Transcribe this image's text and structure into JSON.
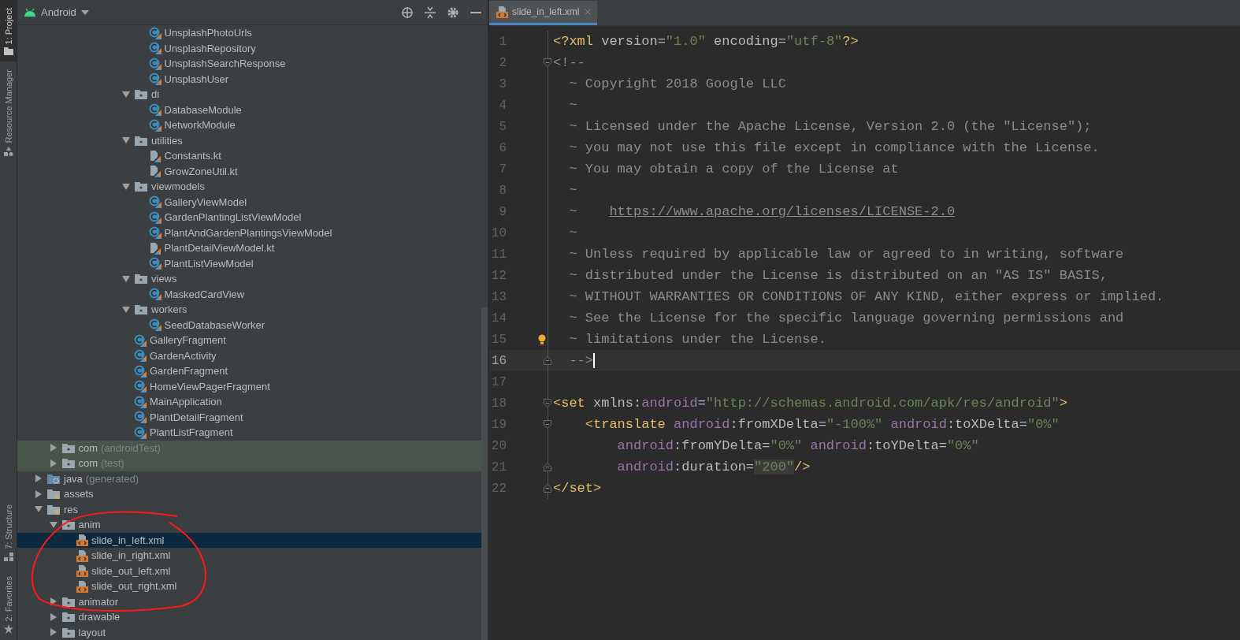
{
  "tool_strip": {
    "top": [
      {
        "label": "1: Project",
        "selected": true,
        "kind": "project"
      },
      {
        "label": "Resource Manager",
        "selected": false,
        "kind": "resources"
      }
    ],
    "bottom": [
      {
        "label": "7: Structure",
        "selected": false,
        "kind": "structure"
      },
      {
        "label": "2: Favorites",
        "selected": false,
        "kind": "favorites"
      }
    ]
  },
  "project": {
    "view": "Android",
    "tree": [
      {
        "children": [
          {
            "children": [
              {
                "children": [
                  {
                    "children": [
                      {
                        "children": [
                          {
                            "children": [
                              {
                                "children": [
                                  {
                                    "label": "UnsplashPhotoUrls",
                                    "kind": "class",
                                    "selected": false
                                  },
                                  {
                                    "label": "UnsplashRepository",
                                    "kind": "class",
                                    "selected": false
                                  },
                                  {
                                    "label": "UnsplashSearchResponse",
                                    "kind": "class",
                                    "selected": false
                                  },
                                  {
                                    "label": "UnsplashUser",
                                    "kind": "class",
                                    "selected": false
                                  }
                                ]
                              },
                              {
                                "label": "di",
                                "kind": "folder",
                                "selected": false,
                                "expanded": true,
                                "children": [
                                  {
                                    "label": "DatabaseModule",
                                    "kind": "class",
                                    "selected": false
                                  },
                                  {
                                    "label": "NetworkModule",
                                    "kind": "class",
                                    "selected": false
                                  }
                                ]
                              },
                              {
                                "label": "utilities",
                                "kind": "folder",
                                "selected": false,
                                "expanded": true,
                                "children": [
                                  {
                                    "label": "Constants.kt",
                                    "kind": "kotlin-file",
                                    "selected": false
                                  },
                                  {
                                    "label": "GrowZoneUtil.kt",
                                    "kind": "kotlin-file",
                                    "selected": false
                                  }
                                ]
                              },
                              {
                                "label": "viewmodels",
                                "kind": "folder",
                                "selected": false,
                                "expanded": true,
                                "children": [
                                  {
                                    "label": "GalleryViewModel",
                                    "kind": "class",
                                    "selected": false
                                  },
                                  {
                                    "label": "GardenPlantingListViewModel",
                                    "kind": "class",
                                    "selected": false
                                  },
                                  {
                                    "label": "PlantAndGardenPlantingsViewModel",
                                    "kind": "class",
                                    "selected": false
                                  },
                                  {
                                    "label": "PlantDetailViewModel.kt",
                                    "kind": "kotlin-file",
                                    "selected": false
                                  },
                                  {
                                    "label": "PlantListViewModel",
                                    "kind": "class",
                                    "selected": false
                                  }
                                ]
                              },
                              {
                                "label": "views",
                                "kind": "folder",
                                "selected": false,
                                "expanded": true,
                                "children": [
                                  {
                                    "label": "MaskedCardView",
                                    "kind": "class",
                                    "selected": false
                                  }
                                ]
                              },
                              {
                                "label": "workers",
                                "kind": "folder",
                                "selected": false,
                                "expanded": true,
                                "children": [
                                  {
                                    "label": "SeedDatabaseWorker",
                                    "kind": "class",
                                    "selected": false
                                  }
                                ]
                              },
                              {
                                "label": "GalleryFragment",
                                "kind": "class",
                                "selected": false
                              },
                              {
                                "label": "GardenActivity",
                                "kind": "class",
                                "selected": false
                              },
                              {
                                "label": "GardenFragment",
                                "kind": "class",
                                "selected": false
                              },
                              {
                                "label": "HomeViewPagerFragment",
                                "kind": "class",
                                "selected": false
                              },
                              {
                                "label": "MainApplication",
                                "kind": "class",
                                "selected": false
                              },
                              {
                                "label": "PlantDetailFragment",
                                "kind": "class",
                                "selected": false
                              },
                              {
                                "label": "PlantListFragment",
                                "kind": "class",
                                "selected": false
                              }
                            ]
                          }
                        ]
                      }
                    ]
                  }
                ]
              }
            ]
          },
          {
            "label": "com",
            "note": "(androidTest)",
            "kind": "folder",
            "selected": false,
            "expanded": false,
            "tinted": true
          },
          {
            "label": "com",
            "note": "(test)",
            "kind": "folder",
            "selected": false,
            "expanded": false,
            "tinted": true
          }
        ]
      },
      {
        "label": "java",
        "note": "(generated)",
        "kind": "folder-generated",
        "selected": false,
        "expanded": false
      },
      {
        "label": "assets",
        "kind": "folder-resource",
        "selected": false,
        "expanded": false
      },
      {
        "label": "res",
        "kind": "folder-resource",
        "selected": false,
        "expanded": true,
        "children": [
          {
            "label": "anim",
            "kind": "folder",
            "selected": false,
            "expanded": true,
            "children": [
              {
                "label": "slide_in_left.xml",
                "kind": "xml",
                "selected": true
              },
              {
                "label": "slide_in_right.xml",
                "kind": "xml",
                "selected": false
              },
              {
                "label": "slide_out_left.xml",
                "kind": "xml",
                "selected": false
              },
              {
                "label": "slide_out_right.xml",
                "kind": "xml",
                "selected": false
              }
            ]
          },
          {
            "label": "animator",
            "kind": "folder",
            "selected": false,
            "expanded": false
          },
          {
            "label": "drawable",
            "kind": "folder",
            "selected": false,
            "expanded": false
          },
          {
            "label": "layout",
            "kind": "folder",
            "selected": false,
            "expanded": false
          }
        ]
      }
    ]
  },
  "editor": {
    "tabs": [
      {
        "label": "slide_in_left.xml",
        "selected": true
      }
    ],
    "lines": [
      {
        "number": "1",
        "current": false,
        "kind": "plain",
        "segments": [
          {
            "kind": "tag",
            "text": "<?xml"
          },
          {
            "kind": "attr",
            "text": " version"
          },
          {
            "kind": "plain",
            "text": "="
          },
          {
            "kind": "value",
            "text": "\"1.0\""
          },
          {
            "kind": "attr",
            "text": " encoding"
          },
          {
            "kind": "plain",
            "text": "="
          },
          {
            "kind": "value",
            "text": "\"utf-8\""
          },
          {
            "kind": "tag",
            "text": "?>"
          }
        ]
      },
      {
        "number": "2",
        "current": false,
        "kind": "fold-start",
        "segments": [
          {
            "kind": "comment",
            "text": "<!--"
          }
        ]
      },
      {
        "number": "3",
        "current": false,
        "kind": "plain",
        "segments": [
          {
            "kind": "comment",
            "text": "  ~ Copyright 2018 Google LLC"
          }
        ]
      },
      {
        "number": "4",
        "current": false,
        "kind": "plain",
        "segments": [
          {
            "kind": "comment",
            "text": "  ~"
          }
        ]
      },
      {
        "number": "5",
        "current": false,
        "kind": "plain",
        "segments": [
          {
            "kind": "comment",
            "text": "  ~ Licensed under the Apache License, Version 2.0 (the \"License\");"
          }
        ]
      },
      {
        "number": "6",
        "current": false,
        "kind": "plain",
        "segments": [
          {
            "kind": "comment",
            "text": "  ~ you may not use this file except in compliance with the License."
          }
        ]
      },
      {
        "number": "7",
        "current": false,
        "kind": "plain",
        "segments": [
          {
            "kind": "comment",
            "text": "  ~ You may obtain a copy of the License at"
          }
        ]
      },
      {
        "number": "8",
        "current": false,
        "kind": "plain",
        "segments": [
          {
            "kind": "comment",
            "text": "  ~"
          }
        ]
      },
      {
        "number": "9",
        "current": false,
        "kind": "plain",
        "segments": [
          {
            "kind": "comment",
            "text": "  ~    "
          },
          {
            "kind": "link",
            "text": "https://www.apache.org/licenses/LICENSE-2.0"
          }
        ]
      },
      {
        "number": "10",
        "current": false,
        "kind": "plain",
        "segments": [
          {
            "kind": "comment",
            "text": "  ~"
          }
        ]
      },
      {
        "number": "11",
        "current": false,
        "kind": "plain",
        "segments": [
          {
            "kind": "comment",
            "text": "  ~ Unless required by applicable law or agreed to in writing, software"
          }
        ]
      },
      {
        "number": "12",
        "current": false,
        "kind": "plain",
        "segments": [
          {
            "kind": "comment",
            "text": "  ~ distributed under the License is distributed on an \"AS IS\" BASIS,"
          }
        ]
      },
      {
        "number": "13",
        "current": false,
        "kind": "plain",
        "segments": [
          {
            "kind": "comment",
            "text": "  ~ WITHOUT WARRANTIES OR CONDITIONS OF ANY KIND, either express or implied."
          }
        ]
      },
      {
        "number": "14",
        "current": false,
        "kind": "plain",
        "segments": [
          {
            "kind": "comment",
            "text": "  ~ See the License for the specific language governing permissions and"
          }
        ]
      },
      {
        "number": "15",
        "current": false,
        "kind": "bulb",
        "segments": [
          {
            "kind": "comment",
            "text": "  ~ limitations under the License."
          }
        ]
      },
      {
        "number": "16",
        "current": true,
        "kind": "fold-end",
        "segments": [
          {
            "kind": "comment",
            "text": "  -->"
          }
        ]
      },
      {
        "number": "17",
        "current": false,
        "kind": "plain"
      },
      {
        "number": "18",
        "current": false,
        "kind": "fold-start",
        "segments": [
          {
            "kind": "tag",
            "text": "<set"
          },
          {
            "kind": "attr",
            "text": " xmlns:"
          },
          {
            "kind": "ns",
            "text": "android"
          },
          {
            "kind": "plain",
            "text": "="
          },
          {
            "kind": "value",
            "text": "\"http://schemas.android.com/apk/res/android\""
          },
          {
            "kind": "tag",
            "text": ">"
          }
        ]
      },
      {
        "number": "19",
        "current": false,
        "kind": "fold-start",
        "segments": [
          {
            "kind": "tag",
            "text": "    <translate"
          },
          {
            "kind": "ns",
            "text": " android"
          },
          {
            "kind": "attr",
            "text": ":fromXDelta"
          },
          {
            "kind": "plain",
            "text": "="
          },
          {
            "kind": "value",
            "text": "\"-100%\""
          },
          {
            "kind": "ns",
            "text": " android"
          },
          {
            "kind": "attr",
            "text": ":toXDelta"
          },
          {
            "kind": "plain",
            "text": "="
          },
          {
            "kind": "value",
            "text": "\"0%\""
          }
        ]
      },
      {
        "number": "20",
        "current": false,
        "kind": "plain",
        "segments": [
          {
            "kind": "ns",
            "text": "        android"
          },
          {
            "kind": "attr",
            "text": ":fromYDelta"
          },
          {
            "kind": "plain",
            "text": "="
          },
          {
            "kind": "value",
            "text": "\"0%\""
          },
          {
            "kind": "ns",
            "text": " android"
          },
          {
            "kind": "attr",
            "text": ":toYDelta"
          },
          {
            "kind": "plain",
            "text": "="
          },
          {
            "kind": "value",
            "text": "\"0%\""
          }
        ]
      },
      {
        "number": "21",
        "current": false,
        "kind": "fold-end",
        "segments": [
          {
            "kind": "ns",
            "text": "        android"
          },
          {
            "kind": "attr",
            "text": ":duration"
          },
          {
            "kind": "plain",
            "text": "="
          },
          {
            "kind": "value-highlight",
            "text": "\"200\""
          },
          {
            "kind": "tag",
            "text": "/>"
          }
        ]
      },
      {
        "number": "22",
        "current": false,
        "kind": "fold-end",
        "segments": [
          {
            "kind": "tag",
            "text": "</set>"
          }
        ]
      }
    ]
  }
}
